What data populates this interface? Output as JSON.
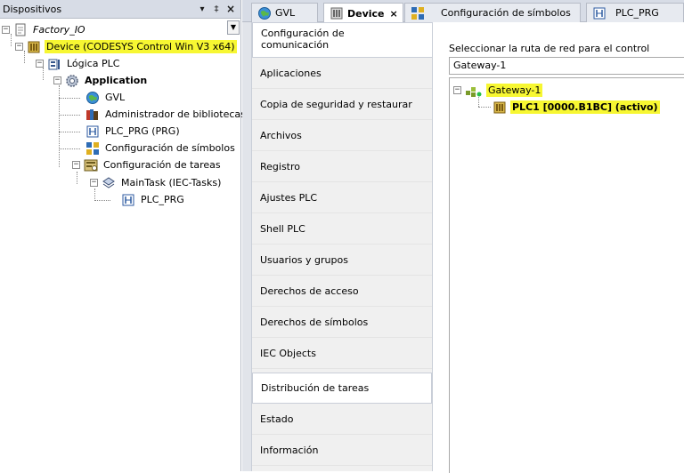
{
  "devices_panel": {
    "title": "Dispositivos",
    "header_buttons": {
      "dropdown": "▾",
      "pin": "‡",
      "close": "×"
    },
    "tree": {
      "project": "Factory_IO",
      "device": "Device (CODESYS Control Win V3 x64)",
      "plc_logic": "Lógica PLC",
      "application": "Application",
      "gvl": "GVL",
      "library_manager": "Administrador de bibliotecas",
      "plc_prg": "PLC_PRG (PRG)",
      "symbol_config": "Configuración de símbolos",
      "task_config": "Configuración de tareas",
      "main_task": "MainTask (IEC-Tasks)",
      "task_plc_prg": "PLC_PRG"
    }
  },
  "tabs": [
    {
      "label": "GVL",
      "icon": "globe-icon"
    },
    {
      "label": "Device",
      "icon": "device-icon"
    },
    {
      "label": "Configuración de símbolos",
      "icon": "symbol-config-icon"
    },
    {
      "label": "PLC_PRG",
      "icon": "program-icon"
    }
  ],
  "side_nav": [
    "Configuración de comunicación",
    "Aplicaciones",
    "Copia de seguridad y restaurar",
    "Archivos",
    "Registro",
    "Ajustes PLC",
    "Shell PLC",
    "Usuarios y grupos",
    "Derechos de acceso",
    "Derechos de símbolos",
    "IEC Objects",
    "Distribución de tareas",
    "Estado",
    "Información"
  ],
  "communication": {
    "route_label": "Seleccionar la ruta de red para el control",
    "gateway_value": "Gateway-1",
    "network": {
      "gateway": "Gateway-1",
      "plc": "PLC1 [0000.B1BC] (activo)"
    }
  },
  "colors": {
    "highlight": "#f7f732",
    "panel_header": "#d7dce6",
    "border": "#b7bcc7"
  }
}
